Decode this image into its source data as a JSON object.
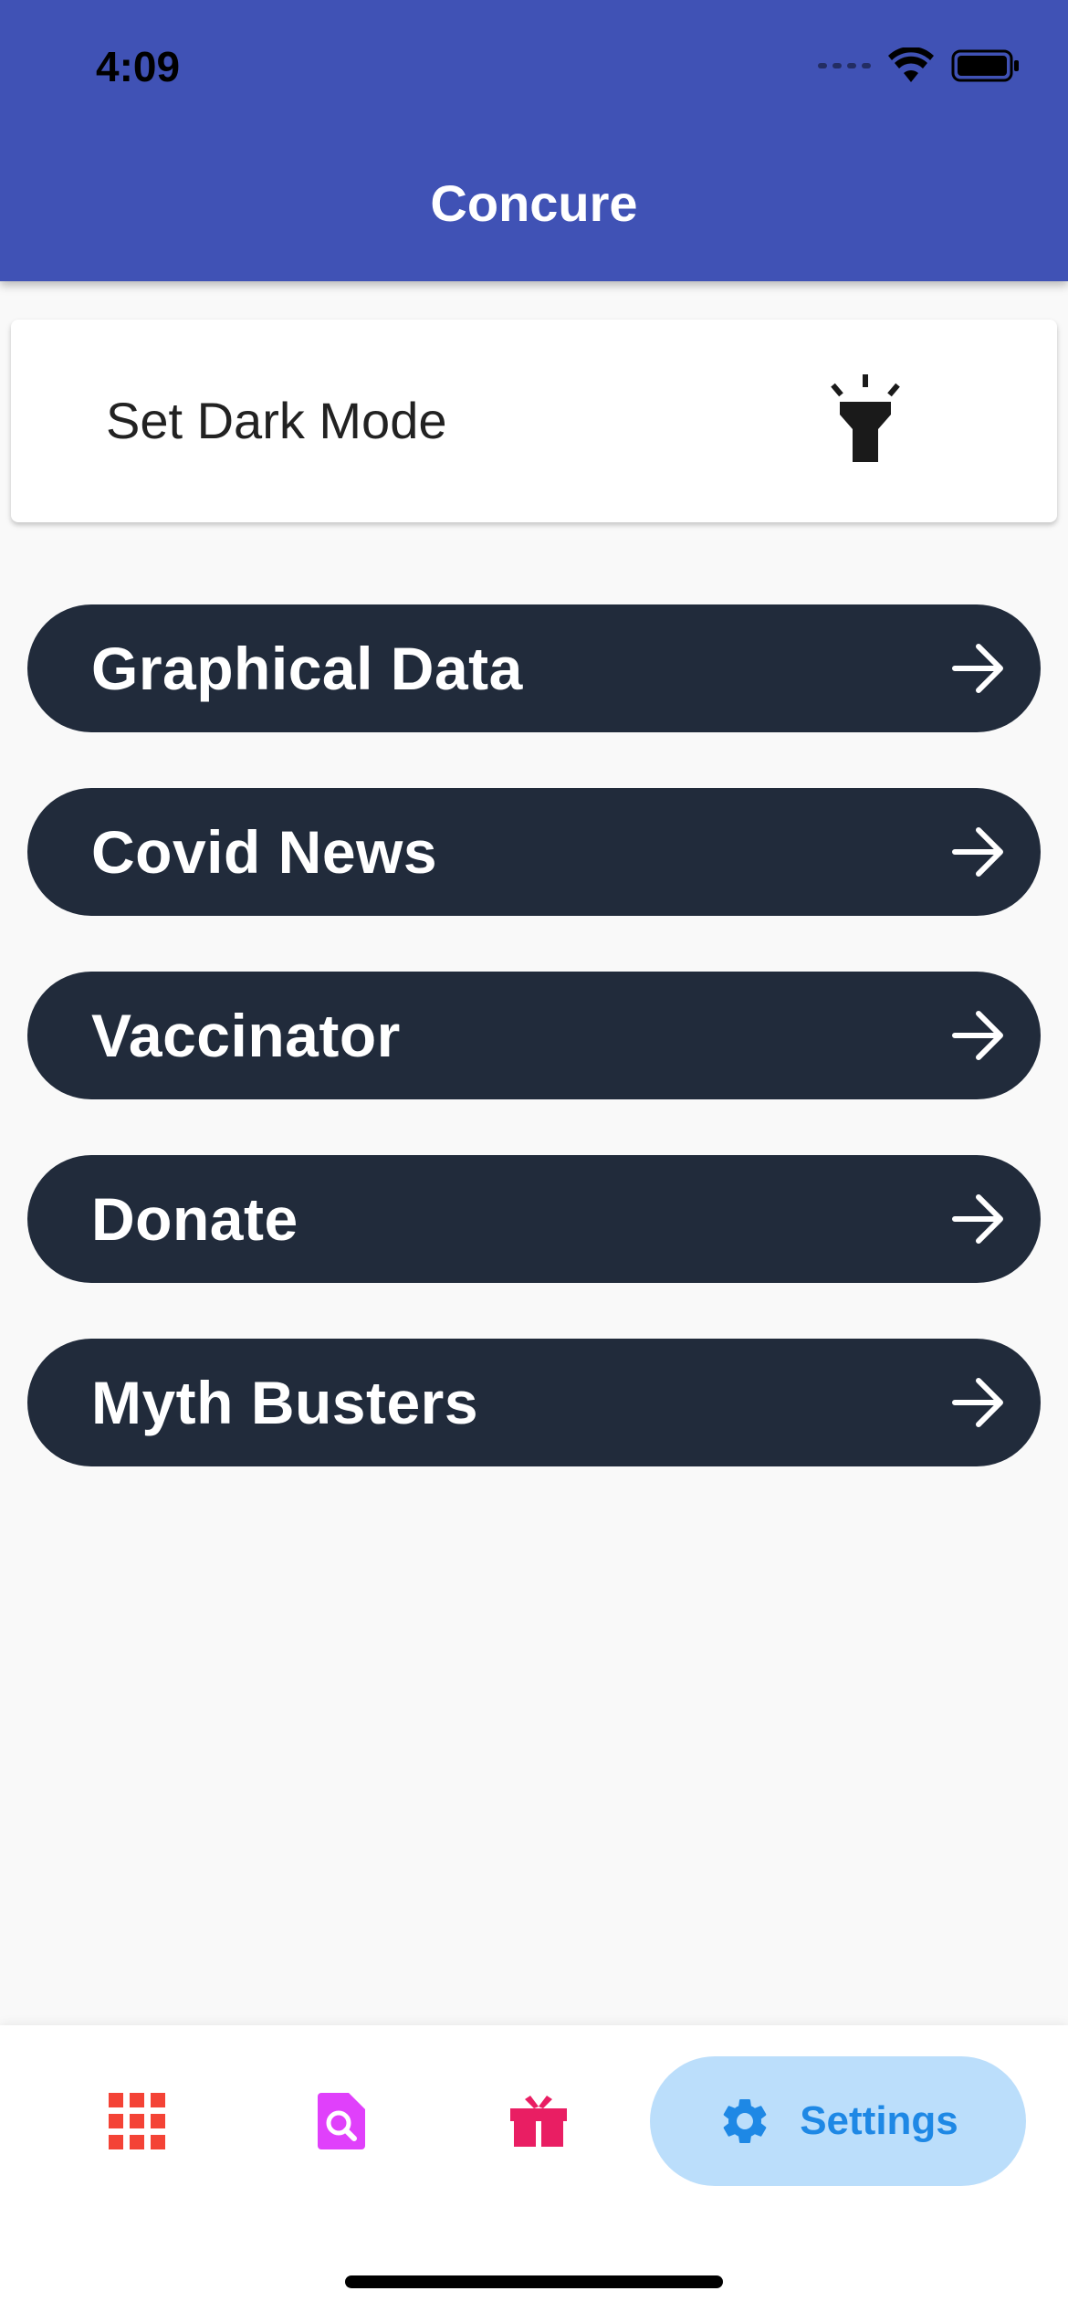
{
  "status_bar": {
    "time": "4:09"
  },
  "app_bar": {
    "title": "Concure",
    "color": "#4052b5"
  },
  "dark_mode": {
    "label": "Set Dark Mode",
    "icon": "flashlight-icon"
  },
  "menu": {
    "items": [
      {
        "label": "Graphical Data",
        "icon": "arrow-right-icon"
      },
      {
        "label": "Covid News",
        "icon": "arrow-right-icon"
      },
      {
        "label": "Vaccinator",
        "icon": "arrow-right-icon"
      },
      {
        "label": "Donate",
        "icon": "arrow-right-icon"
      },
      {
        "label": "Myth Busters",
        "icon": "arrow-right-icon"
      }
    ],
    "color": "#212b3b"
  },
  "bottom_nav": {
    "items": [
      {
        "icon": "grid-icon",
        "color": "#f44336"
      },
      {
        "icon": "document-search-icon",
        "color": "#e040fb"
      },
      {
        "icon": "gift-icon",
        "color": "#e91e63"
      },
      {
        "icon": "gear-icon",
        "label": "Settings",
        "color": "#1e88e5",
        "selected": true
      }
    ],
    "selected_background": "#bbdefb"
  }
}
